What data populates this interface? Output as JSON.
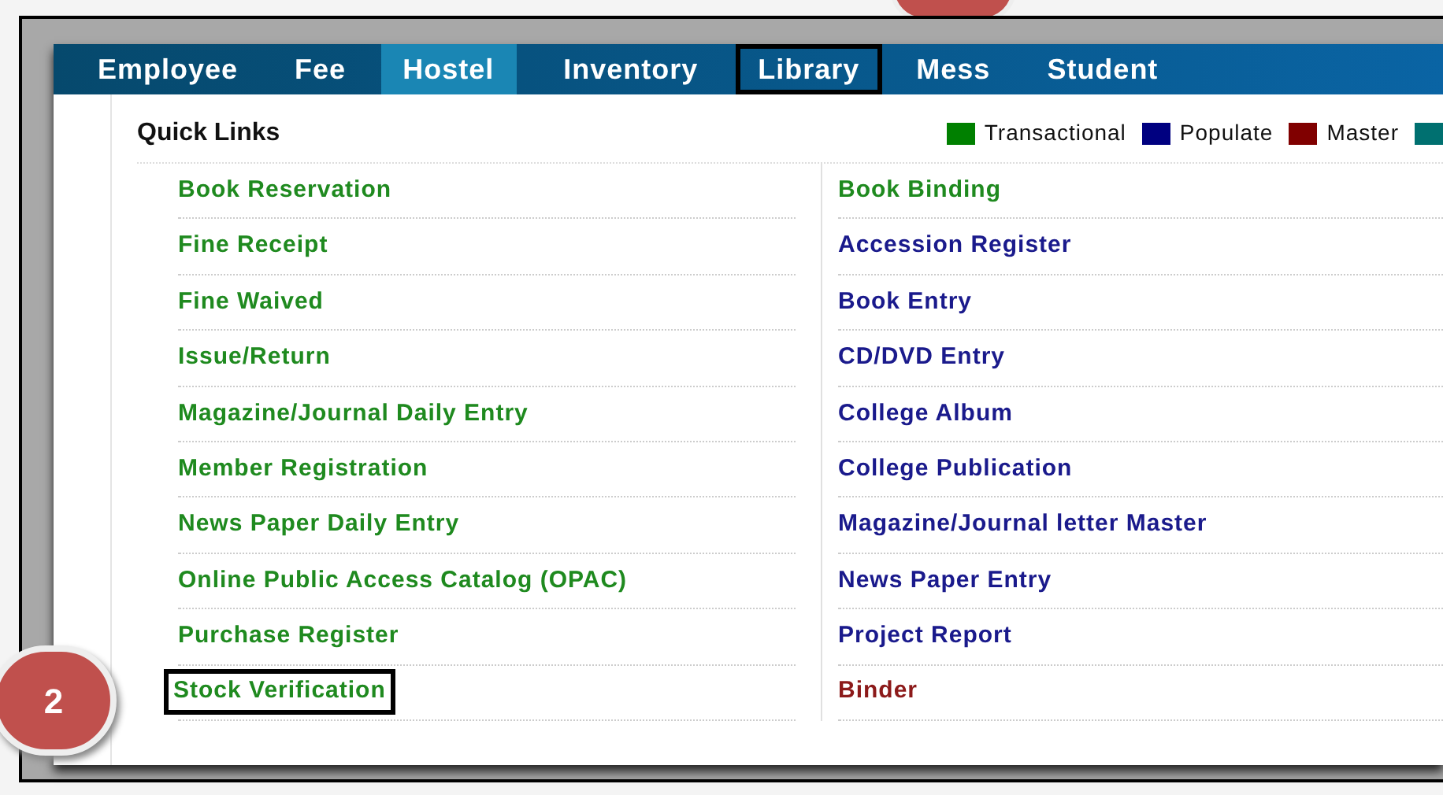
{
  "nav": [
    {
      "label": "Employee",
      "selected": false,
      "highlighted": false
    },
    {
      "label": "Fee",
      "selected": false,
      "highlighted": false
    },
    {
      "label": "Hostel",
      "selected": true,
      "highlighted": false
    },
    {
      "label": "Inventory",
      "selected": false,
      "highlighted": false
    },
    {
      "label": "Library",
      "selected": false,
      "highlighted": true
    },
    {
      "label": "Mess",
      "selected": false,
      "highlighted": false
    },
    {
      "label": "Student",
      "selected": false,
      "highlighted": false
    }
  ],
  "quick_links": {
    "title": "Quick Links",
    "legend": [
      {
        "label": "Transactional",
        "color": "#008000"
      },
      {
        "label": "Populate",
        "color": "#000080"
      },
      {
        "label": "Master",
        "color": "#800000"
      },
      {
        "color": "#007070"
      }
    ],
    "columns": [
      [
        {
          "label": "Book Reservation",
          "kind": "transactional",
          "highlighted": false
        },
        {
          "label": "Fine Receipt",
          "kind": "transactional",
          "highlighted": false
        },
        {
          "label": "Fine Waived",
          "kind": "transactional",
          "highlighted": false
        },
        {
          "label": "Issue/Return",
          "kind": "transactional",
          "highlighted": false
        },
        {
          "label": "Magazine/Journal Daily Entry",
          "kind": "transactional",
          "highlighted": false
        },
        {
          "label": "Member Registration",
          "kind": "transactional",
          "highlighted": false
        },
        {
          "label": "News Paper Daily Entry",
          "kind": "transactional",
          "highlighted": false
        },
        {
          "label": "Online Public Access Catalog (OPAC)",
          "kind": "transactional",
          "highlighted": false
        },
        {
          "label": "Purchase Register",
          "kind": "transactional",
          "highlighted": false
        },
        {
          "label": "Stock Verification",
          "kind": "transactional",
          "highlighted": true
        }
      ],
      [
        {
          "label": "Book Binding",
          "kind": "transactional",
          "highlighted": false
        },
        {
          "label": "Accession Register",
          "kind": "populate",
          "highlighted": false
        },
        {
          "label": "Book Entry",
          "kind": "populate",
          "highlighted": false
        },
        {
          "label": "CD/DVD Entry",
          "kind": "populate",
          "highlighted": false
        },
        {
          "label": "College Album",
          "kind": "populate",
          "highlighted": false
        },
        {
          "label": "College Publication",
          "kind": "populate",
          "highlighted": false
        },
        {
          "label": "Magazine/Journal letter Master",
          "kind": "populate",
          "highlighted": false
        },
        {
          "label": "News Paper Entry",
          "kind": "populate",
          "highlighted": false
        },
        {
          "label": "Project Report",
          "kind": "populate",
          "highlighted": false
        },
        {
          "label": "Binder",
          "kind": "master",
          "highlighted": false
        }
      ]
    ]
  },
  "callout": {
    "label": "2"
  }
}
